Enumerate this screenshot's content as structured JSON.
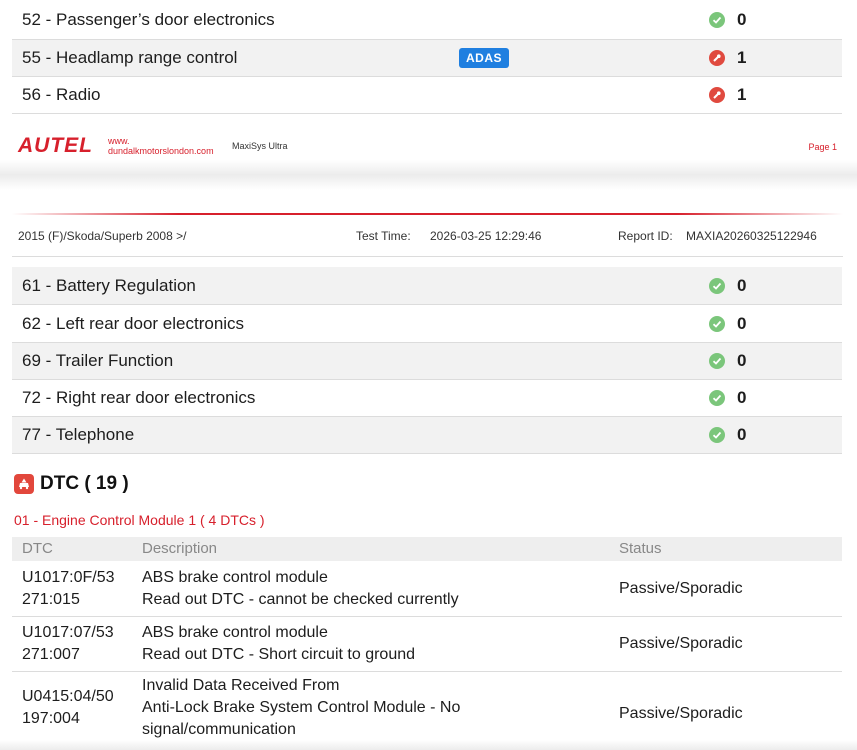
{
  "top_modules": [
    {
      "name": "52 - Passenger’s door electronics",
      "badge": "",
      "status": "ok",
      "count": "0"
    },
    {
      "name": "55 - Headlamp range control",
      "badge": "ADAS",
      "status": "error",
      "count": "1"
    },
    {
      "name": "56 - Radio",
      "badge": "",
      "status": "error",
      "count": "1"
    }
  ],
  "footer": {
    "logo": "AUTEL",
    "www_line1": "www.",
    "www_line2": "dundalkmotorslondon.com",
    "product": "MaxiSys Ultra",
    "page": "Page 1"
  },
  "report_header": {
    "vehicle": "2015 (F)/Skoda/Superb 2008 >/",
    "test_time_label": "Test Time:",
    "test_time": "2026-03-25 12:29:46",
    "report_id_label": "Report ID:",
    "report_id": "MAXIA20260325122946"
  },
  "modules": [
    {
      "name": "61 - Battery Regulation",
      "status": "ok",
      "count": "0"
    },
    {
      "name": "62 - Left rear door electronics",
      "status": "ok",
      "count": "0"
    },
    {
      "name": "69 - Trailer Function",
      "status": "ok",
      "count": "0"
    },
    {
      "name": "72 - Right rear door electronics",
      "status": "ok",
      "count": "0"
    },
    {
      "name": "77 - Telephone",
      "status": "ok",
      "count": "0"
    }
  ],
  "dtc_section": {
    "title": "DTC ( 19 )",
    "module_title": "01 - Engine Control Module 1 ( 4 DTCs )",
    "columns": {
      "dtc": "DTC",
      "description": "Description",
      "status": "Status"
    },
    "rows": [
      {
        "code_1": "U1017:0F/53",
        "code_2": "271:015",
        "desc_1": "ABS brake control module",
        "desc_2": "Read out DTC - cannot be checked currently",
        "desc_3": "",
        "status": "Passive/Sporadic"
      },
      {
        "code_1": "U1017:07/53",
        "code_2": "271:007",
        "desc_1": "ABS brake control module",
        "desc_2": "Read out DTC - Short circuit to ground",
        "desc_3": "",
        "status": "Passive/Sporadic"
      },
      {
        "code_1": "U0415:04/50",
        "code_2": "197:004",
        "desc_1": "Invalid Data Received From",
        "desc_2": "Anti-Lock Brake System Control Module - No",
        "desc_3": "signal/communication",
        "status": "Passive/Sporadic"
      }
    ]
  },
  "colors": {
    "brand_red": "#d7202c",
    "ok_green": "#7bc67b",
    "error_red": "#e04a3f",
    "adas_blue": "#1f7fe0"
  }
}
